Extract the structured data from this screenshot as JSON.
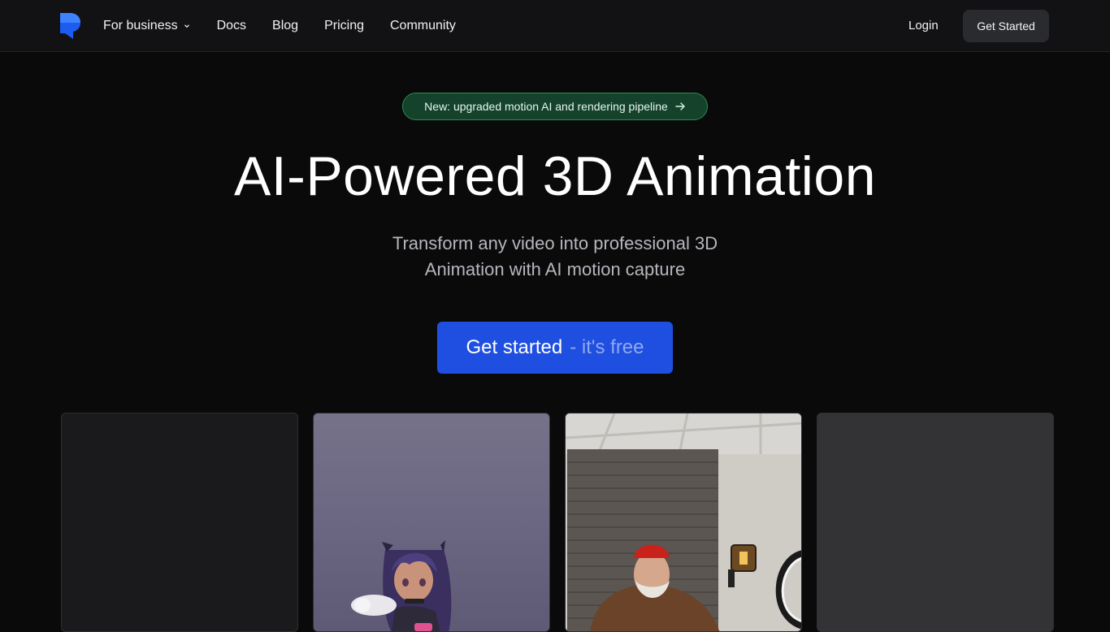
{
  "nav": {
    "logo_icon": "brand-logo-icon",
    "items": [
      {
        "label": "For business",
        "has_dropdown": true
      },
      {
        "label": "Docs"
      },
      {
        "label": "Blog"
      },
      {
        "label": "Pricing"
      },
      {
        "label": "Community"
      }
    ],
    "login_label": "Login",
    "cta_label": "Get Started"
  },
  "hero": {
    "announcement": "New: upgraded motion AI and rendering pipeline",
    "announcement_icon": "arrow-right-icon",
    "title": "AI-Powered 3D Animation",
    "subtitle": "Transform any video into professional 3D Animation with AI motion capture",
    "cta_main": "Get started",
    "cta_sub": "- it's free"
  },
  "cards": [
    {
      "kind": "empty-placeholder"
    },
    {
      "kind": "animated-avatar-preview"
    },
    {
      "kind": "video-preview"
    },
    {
      "kind": "empty-placeholder"
    }
  ],
  "colors": {
    "background": "#0a0a0b",
    "nav_background": "#121214",
    "accent_blue": "#1f4fe0",
    "announcement_green": "#14422b",
    "announcement_border": "#2a8a52"
  }
}
